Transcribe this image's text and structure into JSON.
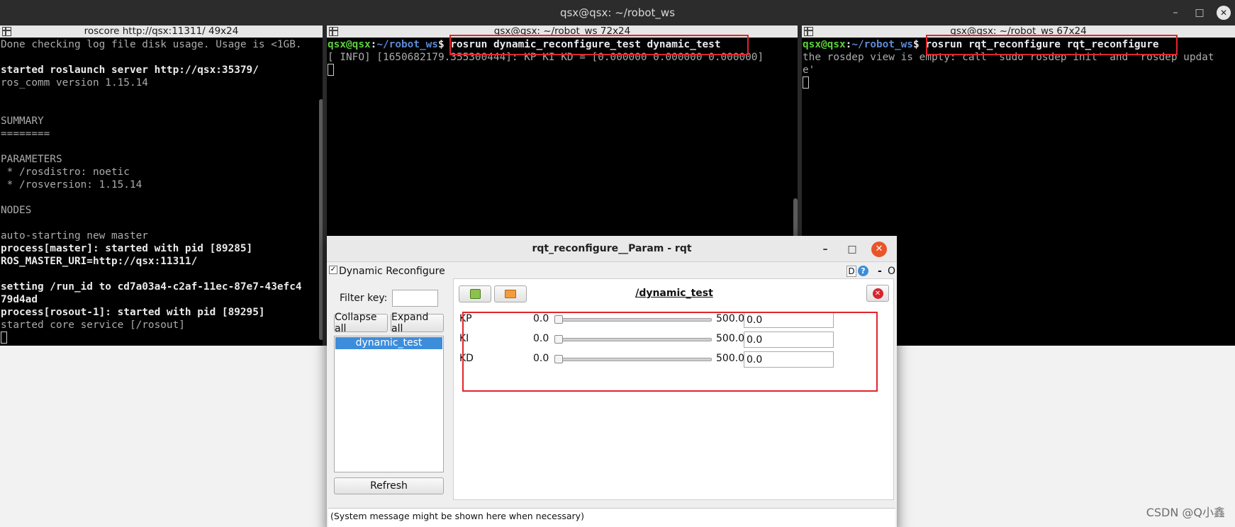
{
  "terminator": {
    "title": "qsx@qsx: ~/robot_ws",
    "controls": {
      "minimize": "–",
      "maximize": "□",
      "close": "✕"
    }
  },
  "pane1": {
    "tab_title": "roscore http://qsx:11311/ 49x24",
    "lines": [
      {
        "text": "Done checking log file disk usage. Usage is <1GB.",
        "bold": false
      },
      {
        "text": "",
        "bold": false
      },
      {
        "text": "started roslaunch server http://qsx:35379/",
        "bold": true
      },
      {
        "text": "ros_comm version 1.15.14",
        "bold": false
      },
      {
        "text": "",
        "bold": false
      },
      {
        "text": "",
        "bold": false
      },
      {
        "text": "SUMMARY",
        "bold": false
      },
      {
        "text": "========",
        "bold": false
      },
      {
        "text": "",
        "bold": false
      },
      {
        "text": "PARAMETERS",
        "bold": false
      },
      {
        "text": " * /rosdistro: noetic",
        "bold": false
      },
      {
        "text": " * /rosversion: 1.15.14",
        "bold": false
      },
      {
        "text": "",
        "bold": false
      },
      {
        "text": "NODES",
        "bold": false
      },
      {
        "text": "",
        "bold": false
      },
      {
        "text": "auto-starting new master",
        "bold": false
      },
      {
        "text": "process[master]: started with pid [89285]",
        "bold": true
      },
      {
        "text": "ROS_MASTER_URI=http://qsx:11311/",
        "bold": true
      },
      {
        "text": "",
        "bold": false
      },
      {
        "text": "setting /run_id to cd7a03a4-c2af-11ec-87e7-43efc4",
        "bold": true
      },
      {
        "text": "79d4ad",
        "bold": true
      },
      {
        "text": "process[rosout-1]: started with pid [89295]",
        "bold": true
      },
      {
        "text": "started core service [/rosout]",
        "bold": false
      }
    ]
  },
  "pane2": {
    "tab_title": "qsx@qsx: ~/robot_ws 72x24",
    "prompt_user": "qsx@qsx",
    "prompt_sep": ":",
    "prompt_path": "~/robot_ws",
    "prompt_end": "$ ",
    "command": "rosrun dynamic_reconfigure_test dynamic_test",
    "output": "[ INFO] [1650682179.355300444]: KP KI KD = [0.000000 0.000000 0.000000]"
  },
  "pane3": {
    "tab_title": "qsx@qsx: ~/robot_ws 67x24",
    "prompt_user": "qsx@qsx",
    "prompt_sep": ":",
    "prompt_path": "~/robot_ws",
    "prompt_end": "$ ",
    "command": "rosrun rqt_reconfigure rqt_reconfigure",
    "output1": "the rosdep view is empty: call 'sudo rosdep init' and 'rosdep updat",
    "output2": "e'"
  },
  "rqt": {
    "title": "rqt_reconfigure__Param - rqt",
    "controls": {
      "minimize": "–",
      "maximize": "□",
      "close": "✕"
    },
    "plugin_title": "Dynamic Reconfigure",
    "plugin_controls": {
      "d": "D",
      "help": "?",
      "dash": "-",
      "o": "O"
    },
    "filter_label": "Filter key:",
    "filter_value": "",
    "collapse_all": "Collapse all",
    "expand_all": "Expand all",
    "node_item": "dynamic_test",
    "refresh": "Refresh",
    "node_title": "/dynamic_test",
    "params": [
      {
        "name": "KP",
        "min": "0.0",
        "max": "500.0",
        "value": "0.0",
        "fraction": 0
      },
      {
        "name": "KI",
        "min": "0.0",
        "max": "500.0",
        "value": "0.0",
        "fraction": 0
      },
      {
        "name": "KD",
        "min": "0.0",
        "max": "500.0",
        "value": "0.0",
        "fraction": 0
      }
    ],
    "status": "(System message might be shown here when necessary)"
  },
  "watermark": "CSDN @Q小鑫",
  "colors": {
    "highlight_box": "#e3242b",
    "prompt_user": "#5bd23a",
    "prompt_path": "#5c8bd6",
    "selection": "#3d8ddb"
  }
}
